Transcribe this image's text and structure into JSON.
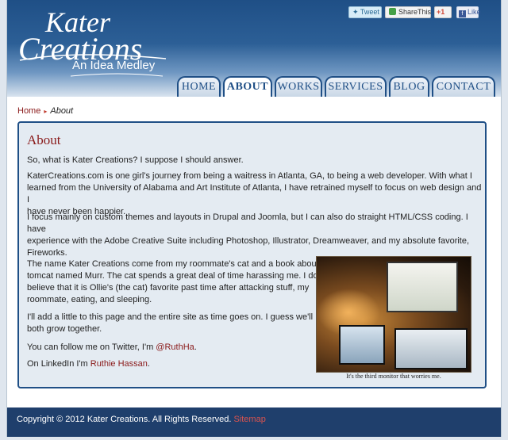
{
  "header": {
    "logo_line1": "Kater",
    "logo_line2": "Creations",
    "tagline": "An Idea Medley"
  },
  "social": {
    "tweet": "Tweet",
    "sharethis": "ShareThis",
    "gplus": "+1",
    "like": "Like"
  },
  "nav": {
    "items": [
      {
        "label": "HOME"
      },
      {
        "label": "ABOUT",
        "active": true
      },
      {
        "label": "WORKS"
      },
      {
        "label": "SERVICES"
      },
      {
        "label": "BLOG"
      },
      {
        "label": "CONTACT"
      }
    ]
  },
  "breadcrumb": {
    "home": "Home",
    "current": "About"
  },
  "content": {
    "title": "About",
    "p1": "So, what is Kater Creations?  I suppose I should answer.",
    "p2a": "KaterCreations.com is one girl's journey from being a waitress in Atlanta, GA, to being a web developer.  With what I",
    "p2b": "learned from the University of Alabama and Art Institute of Atlanta, I have retrained myself to focus on web design and I",
    "p2c": "have never been happier.",
    "p3a": "I focus mainly on custom themes and layouts in Drupal and Joomla, but I can also do straight HTML/CSS coding.  I have",
    "p3b": "experience with the Adobe Creative Suite including Photoshop, Illustrator, Dreamweaver, and my absolute favorite,",
    "p3c": "Fireworks.",
    "p4a": "The name Kater Creations come from my roommate's cat and a book about a",
    "p4b": "tomcat named Murr.  The cat spends a great deal of time harassing me.  I do",
    "p4c": "believe that it is Ollie's (the cat) favorite past time after attacking stuff, my",
    "p4d": "roommate, eating, and sleeping.",
    "p5a": "I'll add a little to this page and the entire site as time goes on.  I guess we'll",
    "p5b": "both grow together.",
    "twitter_prefix": "You can follow me on Twitter, I'm ",
    "twitter_handle": "@RuthHa",
    "twitter_suffix": ".",
    "linkedin_prefix": "On LinkedIn I'm ",
    "linkedin_name": "Ruthie Hassan",
    "linkedin_suffix": ".",
    "photo_caption": "It's the third monitor that worries me."
  },
  "footer": {
    "copyright": "Copyright © 2012 Kater Creations. All Rights Reserved.",
    "sitemap": "Sitemap"
  }
}
